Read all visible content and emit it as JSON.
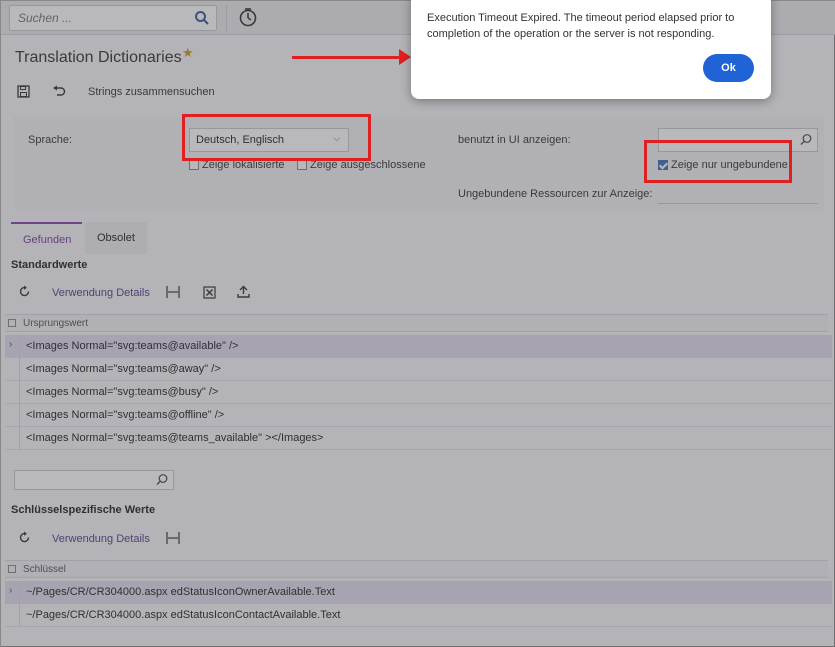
{
  "topbar": {
    "search_placeholder": "Suchen ...",
    "search_icon": "search-icon",
    "history_icon": "history-icon"
  },
  "page": {
    "title": "Translation Dictionaries",
    "favorite_icon": "star-icon",
    "favorite_color": "#c99d1f"
  },
  "toolbar": {
    "save_icon": "save-icon",
    "undo_icon": "undo-icon",
    "merge_label": "Strings zusammensuchen"
  },
  "filter": {
    "language_label": "Sprache:",
    "language_value": "Deutsch, Englisch",
    "show_localized_label": "Zeige lokalisierte",
    "show_localized_checked": false,
    "show_excluded_label": "Zeige ausgeschlossene",
    "show_excluded_checked": false,
    "used_in_ui_label": "benutzt in UI anzeigen:",
    "used_in_ui_value": "",
    "show_unbound_label": "Zeige nur ungebundene",
    "show_unbound_checked": true,
    "unbound_resources_label": "Ungebundene Ressourcen zur Anzeige:"
  },
  "tabs": [
    {
      "label": "Gefunden",
      "active": true
    },
    {
      "label": "Obsolet",
      "active": false
    }
  ],
  "defaults_section": {
    "heading": "Standardwerte",
    "toolbar": {
      "refresh_icon": "refresh-icon",
      "usage_details_label": "Verwendung Details",
      "fit_columns_icon": "fit-columns-icon",
      "excel_icon": "excel-export-icon",
      "upload_icon": "upload-icon"
    },
    "column_header": "Ursprungswert",
    "rows": [
      "<Images Normal=\"svg:teams@available\" />",
      "<Images Normal=\"svg:teams@away\" />",
      "<Images Normal=\"svg:teams@busy\" />",
      "<Images Normal=\"svg:teams@offline\" />",
      "<Images Normal=\"svg:teams@teams_available\" ></Images>"
    ]
  },
  "keyspecific_section": {
    "heading": "Schlüsselspezifische Werte",
    "toolbar": {
      "refresh_icon": "refresh-icon",
      "usage_details_label": "Verwendung Details",
      "fit_columns_icon": "fit-columns-icon"
    },
    "column_header": "Schlüssel",
    "rows": [
      "~/Pages/CR/CR304000.aspx edStatusIconOwnerAvailable.Text",
      "~/Pages/CR/CR304000.aspx edStatusIconContactAvailable.Text"
    ]
  },
  "dialog": {
    "message": "Execution Timeout Expired.  The timeout period elapsed prior to completion of the operation or the server is not responding.",
    "ok_label": "Ok"
  },
  "colors": {
    "accent_purple": "#7a3aa0",
    "annotation_red": "#e02020",
    "ok_button_blue": "#1f63d6"
  }
}
